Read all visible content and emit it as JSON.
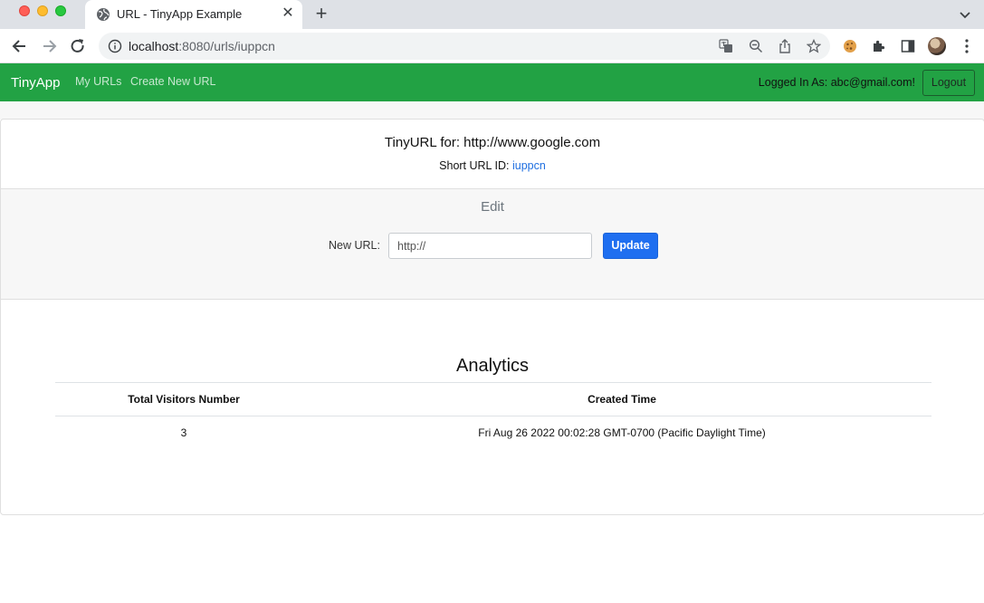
{
  "browser": {
    "tab_title": "URL - TinyApp Example",
    "url_host": "localhost",
    "url_rest": ":8080/urls/iuppcn"
  },
  "navbar": {
    "brand": "TinyApp",
    "links": [
      "My URLs",
      "Create New URL"
    ],
    "logged_in_text": "Logged In As: abc@gmail.com!",
    "logout_label": "Logout"
  },
  "url_card": {
    "title": "TinyURL for: http://www.google.com",
    "short_id_label": "Short URL ID:",
    "short_id": "iuppcn"
  },
  "edit": {
    "heading": "Edit",
    "new_url_label": "New URL:",
    "new_url_placeholder": "http://",
    "update_label": "Update"
  },
  "analytics": {
    "heading": "Analytics",
    "columns": [
      "Total Visitors Number",
      "Created Time"
    ],
    "rows": [
      [
        "3",
        "Fri Aug 26 2022 00:02:28 GMT-0700 (Pacific Daylight Time)"
      ]
    ]
  },
  "colors": {
    "navbar_bg": "#22a244",
    "primary": "#1f6ff0",
    "link": "#1f6fe0"
  }
}
